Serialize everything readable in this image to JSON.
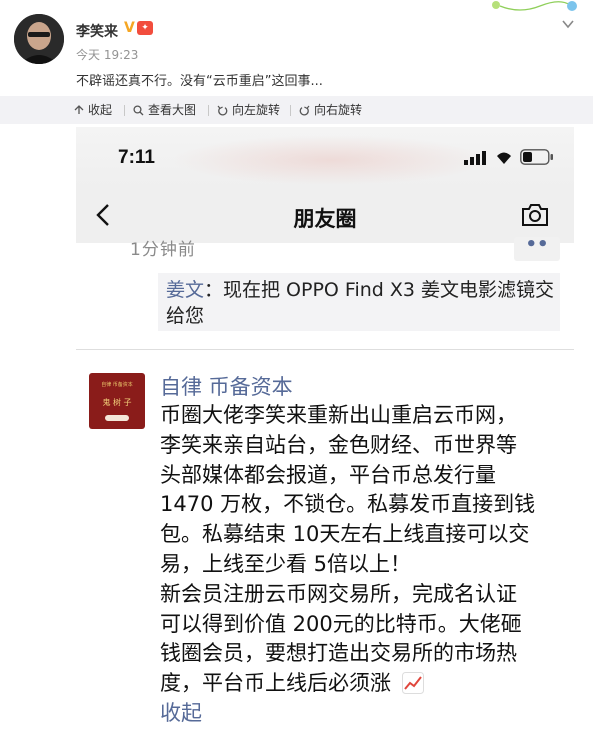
{
  "post": {
    "username": "李笑来",
    "verified_mark": "V",
    "time": "今天 19:23",
    "text": "不辟谣还真不行。没有“云币重启”这回事..."
  },
  "toolbar": {
    "collapse": "收起",
    "view_large": "查看大图",
    "rotate_left": "向左旋转",
    "rotate_right": "向右旋转"
  },
  "screenshot": {
    "status_time": "7:11",
    "nav_title": "朋友圈",
    "cut_text": "1分钟前",
    "more": "••",
    "comment": {
      "name": "姜文",
      "text": "：现在把 OPPO Find X3 姜文电影滤镜交给您"
    },
    "poster_name": "自律 币备资本",
    "poster_avatar_text": "鬼 树 子",
    "poster_avatar_small": "自律 币备资本",
    "body_lines": [
      "币圈大佬李笑来重新出山重启云币网，",
      "李笑来亲自站台，金色财经、币世界等",
      "头部媒体都会报道，平台币总发行量",
      "1470 万枚，不锁仓。私募发币直接到钱",
      "包。私募结束 10天左右上线直接可以交",
      "易，上线至少看 5倍以上！",
      "新会员注册云币网交易所，完成名认证",
      "可以得到价值 200元的比特币。大佬砸",
      "钱圈会员，要想打造出交易所的市场热",
      "度，平台币上线后必须涨"
    ],
    "collapse_link": "收起"
  },
  "colors": {
    "link_blue": "#566a98",
    "toolbar_bg": "#f2f2f5",
    "poster_avatar": "#8a1c1a"
  }
}
